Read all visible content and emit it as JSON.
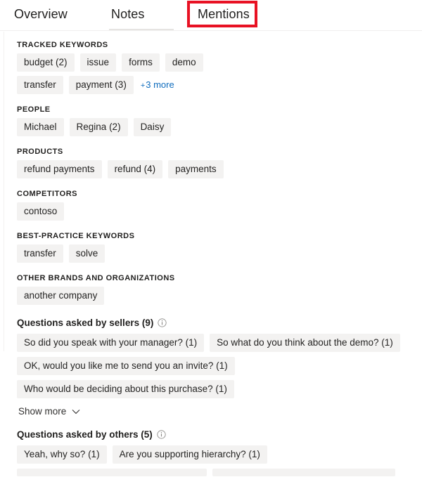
{
  "tabs": [
    {
      "id": "overview",
      "label": "Overview",
      "selected": false
    },
    {
      "id": "notes",
      "label": "Notes",
      "selected": false
    },
    {
      "id": "mentions",
      "label": "Mentions",
      "selected": true
    }
  ],
  "highlight": {
    "target": "Mentions",
    "color": "#e81123"
  },
  "colors": {
    "chip_background": "#f3f2f1",
    "link": "#0f6cbd",
    "text": "#201f1e",
    "page_background": "#ffffff"
  },
  "sections": [
    {
      "title": "TRACKED KEYWORDS",
      "chips": [
        "budget (2)",
        "issue",
        "forms",
        "demo",
        "transfer",
        "payment (3)"
      ],
      "more_label": "+ 3 more",
      "more_plus": "+",
      "more_text": "3 more"
    },
    {
      "title": "PEOPLE",
      "chips": [
        "Michael",
        "Regina (2)",
        "Daisy"
      ]
    },
    {
      "title": "PRODUCTS",
      "chips": [
        "refund payments",
        "refund (4)",
        "payments"
      ]
    },
    {
      "title": "COMPETITORS",
      "chips": [
        "contoso"
      ]
    },
    {
      "title": "BEST-PRACTICE KEYWORDS",
      "chips": [
        "transfer",
        "solve"
      ]
    },
    {
      "title": "OTHER BRANDS AND ORGANIZATIONS",
      "chips": [
        "another company"
      ]
    }
  ],
  "questions_sellers": {
    "heading": "Questions asked by sellers (9)",
    "info_icon": "info-circle-icon",
    "chips": [
      "So did you speak with your manager? (1)",
      "So what do you think about the demo? (1)",
      "OK, would you like me to send you an invite? (1)",
      "Who would be deciding about this purchase? (1)"
    ],
    "show_more_label": "Show more",
    "chevron_icon": "chevron-down-icon"
  },
  "questions_others": {
    "heading": "Questions asked by others (5)",
    "info_icon": "info-circle-icon",
    "chips": [
      "Yeah, why so? (1)",
      "Are you supporting hierarchy? (1)",
      "",
      ""
    ]
  }
}
